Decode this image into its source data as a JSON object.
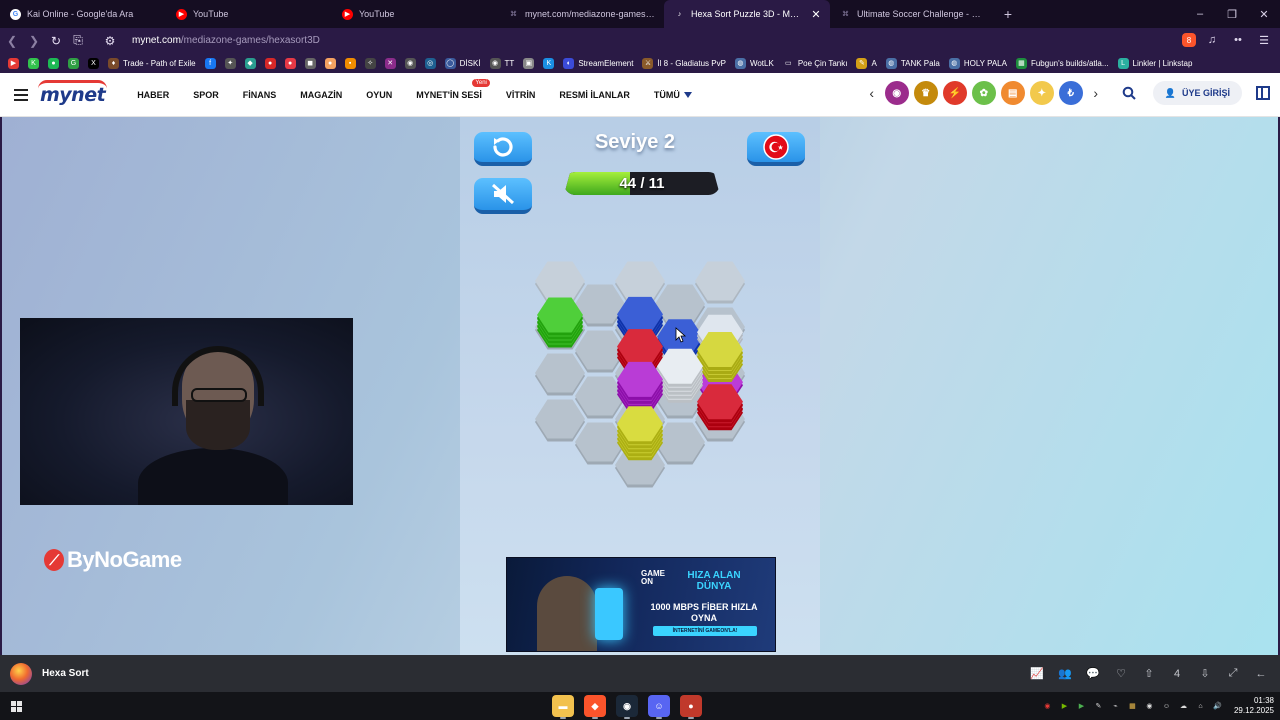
{
  "browser": {
    "tabs": [
      {
        "title": "Kai Online - Google'da Ara",
        "icon": "google-icon",
        "color": "#ffffff",
        "active": false
      },
      {
        "title": "YouTube",
        "icon": "youtube-icon",
        "color": "#ff0000",
        "active": false
      },
      {
        "title": "YouTube",
        "icon": "youtube-icon",
        "color": "#ff0000",
        "active": false
      },
      {
        "title": "mynet.com/mediazone-games/all-g",
        "icon": "link-icon",
        "color": "#8a7fa3",
        "active": false
      },
      {
        "title": "Hexa Sort Puzzle 3D - Media",
        "icon": "audio-icon",
        "color": "#ffffff",
        "active": true
      },
      {
        "title": "Ultimate Soccer Challenge - Mediaz",
        "icon": "link-icon",
        "color": "#8a7fa3",
        "active": false
      }
    ],
    "new_tab": "+",
    "window_controls": {
      "minimize": "–",
      "restore": "❐",
      "close": "✕"
    },
    "url_host": "mynet.com",
    "url_path": "/mediazone-games/hexasort3D",
    "brave_badge": "8",
    "bookmarks": [
      {
        "label": "",
        "color": "#e53935",
        "glyph": "▶"
      },
      {
        "label": "",
        "color": "#32c24d",
        "glyph": "K"
      },
      {
        "label": "",
        "color": "#1db954",
        "glyph": "●"
      },
      {
        "label": "",
        "color": "#2f9e44",
        "glyph": "G"
      },
      {
        "label": "",
        "color": "#000000",
        "glyph": "X"
      },
      {
        "label": "Trade - Path of Exile",
        "color": "#7a4a2a",
        "glyph": "♦"
      },
      {
        "label": "",
        "color": "#1877f2",
        "glyph": "f"
      },
      {
        "label": "",
        "color": "#555",
        "glyph": "✦"
      },
      {
        "label": "",
        "color": "#2a9d8f",
        "glyph": "◆"
      },
      {
        "label": "",
        "color": "#d62828",
        "glyph": "●"
      },
      {
        "label": "",
        "color": "#e63946",
        "glyph": "●"
      },
      {
        "label": "",
        "color": "#666",
        "glyph": "◼"
      },
      {
        "label": "",
        "color": "#f4a261",
        "glyph": "●"
      },
      {
        "label": "",
        "color": "#f08c00",
        "glyph": "▪"
      },
      {
        "label": "",
        "color": "#444",
        "glyph": "✧"
      },
      {
        "label": "",
        "color": "#8b2c8b",
        "glyph": "✕"
      },
      {
        "label": "",
        "color": "#555",
        "glyph": "◉"
      },
      {
        "label": "",
        "color": "#1e6091",
        "glyph": "◎"
      },
      {
        "label": "DİSKİ",
        "color": "#3a5a9c",
        "glyph": "◯"
      },
      {
        "label": "TT",
        "color": "#555",
        "glyph": "◉"
      },
      {
        "label": "",
        "color": "#888",
        "glyph": "▣"
      },
      {
        "label": "",
        "color": "#1a8fe3",
        "glyph": "K"
      },
      {
        "label": "StreamElement",
        "color": "#3b4bd8",
        "glyph": "◐"
      },
      {
        "label": "İl 8 - Gladiatus PvP",
        "color": "#8a5a2a",
        "glyph": "⚔"
      },
      {
        "label": "WotLK",
        "color": "#4a6fa5",
        "glyph": "◍"
      },
      {
        "label": "Poe Çin Tankı",
        "color": "#2a1a45",
        "glyph": "▭"
      },
      {
        "label": "A",
        "color": "#d4a017",
        "glyph": "✎"
      },
      {
        "label": "TANK Pala",
        "color": "#4a6fa5",
        "glyph": "◍"
      },
      {
        "label": "HOLY PALA",
        "color": "#4a6fa5",
        "glyph": "◍"
      },
      {
        "label": "Fubgun's builds/atla...",
        "color": "#1e8e3e",
        "glyph": "▦"
      },
      {
        "label": "Linkler | Linkstap",
        "color": "#2bb0a0",
        "glyph": "L"
      }
    ]
  },
  "site": {
    "logo": "mynet",
    "nav": [
      "HABER",
      "SPOR",
      "FİNANS",
      "MAGAZİN",
      "OYUN",
      "MYNET'İN SESİ",
      "VİTRİN",
      "RESMİ İLANLAR",
      "TÜMÜ"
    ],
    "new_badge": "Yeni",
    "app_icons": [
      {
        "name": "podcast-icon",
        "color": "#9b2c8c",
        "glyph": "◉"
      },
      {
        "name": "trophy-icon",
        "color": "#c48a0c",
        "glyph": "♛"
      },
      {
        "name": "flash-icon",
        "color": "#e03a2a",
        "glyph": "⚡"
      },
      {
        "name": "sport-icon",
        "color": "#6cc04a",
        "glyph": "✿"
      },
      {
        "name": "live-icon",
        "color": "#f08a30",
        "glyph": "▤"
      },
      {
        "name": "gift-icon",
        "color": "#f2c94c",
        "glyph": "✦"
      },
      {
        "name": "finance-icon",
        "color": "#3a6ed8",
        "glyph": "₺"
      }
    ],
    "login_label": "ÜYE GİRİŞİ"
  },
  "stream": {
    "brand": "ByNoGame"
  },
  "game": {
    "level": "Seviye 2",
    "progress_text": "44 / 11",
    "progress_fraction": 0.42,
    "flag": "Turkish flag",
    "ad": {
      "line1": "GAME ON",
      "line2": "HIZA ALAN DÜNYA",
      "line3": "1000 MBPS FİBER HIZLA OYNA",
      "line4": "İNTERNETİNİ GAMEON'LA!"
    }
  },
  "appbar": {
    "title": "Hexa Sort",
    "count": "4"
  },
  "taskbar": {
    "time": "01:38",
    "date": "29.12.2025",
    "apps": [
      {
        "name": "file-explorer-icon",
        "color": "#f2c14e",
        "glyph": "▬"
      },
      {
        "name": "brave-browser-icon",
        "color": "#fb542b",
        "glyph": "◆"
      },
      {
        "name": "steam-icon",
        "color": "#1b2838",
        "glyph": "◉"
      },
      {
        "name": "discord-icon",
        "color": "#5865f2",
        "glyph": "☺"
      },
      {
        "name": "obs-icon",
        "color": "#c0392b",
        "glyph": "●"
      }
    ]
  },
  "board_cells": [
    {
      "col": 0,
      "row": 0,
      "color": "#c6d0da"
    },
    {
      "col": 0,
      "row": 1,
      "color": "#b7c2cd"
    },
    {
      "col": 0,
      "row": 2,
      "color": "#b7c2cd"
    },
    {
      "col": 0,
      "row": 3,
      "color": "#b7c2cd"
    },
    {
      "col": 1,
      "row": 0.5,
      "color": "#b7c2cd"
    },
    {
      "col": 1,
      "row": 1.5,
      "color": "#b7c2cd"
    },
    {
      "col": 1,
      "row": 2.5,
      "color": "#b7c2cd"
    },
    {
      "col": 1,
      "row": 3.5,
      "color": "#b7c2cd"
    },
    {
      "col": 2,
      "row": 0,
      "color": "#c6d0da"
    },
    {
      "col": 2,
      "row": 1,
      "color": "#b7c2cd"
    },
    {
      "col": 2,
      "row": 2,
      "color": "#b7c2cd"
    },
    {
      "col": 2,
      "row": 3,
      "color": "#b7c2cd"
    },
    {
      "col": 2,
      "row": 4,
      "color": "#b7c2cd"
    },
    {
      "col": 3,
      "row": 0.5,
      "color": "#b7c2cd"
    },
    {
      "col": 3,
      "row": 1.5,
      "color": "#b7c2cd"
    },
    {
      "col": 3,
      "row": 2.5,
      "color": "#b7c2cd"
    },
    {
      "col": 3,
      "row": 3.5,
      "color": "#b7c2cd"
    },
    {
      "col": 4,
      "row": 0,
      "color": "#c6d0da"
    },
    {
      "col": 4,
      "row": 1,
      "color": "#b7c2cd"
    },
    {
      "col": 4,
      "row": 2,
      "color": "#b7c2cd"
    },
    {
      "col": 4,
      "row": 3,
      "color": "#b7c2cd"
    }
  ],
  "stacks": [
    {
      "col": 0,
      "row": 1,
      "color": "#4fcf3a",
      "height": 4
    },
    {
      "col": 2,
      "row": 0.9,
      "color": "#3b5fd6",
      "height": 3
    },
    {
      "col": 3,
      "row": 1.3,
      "color": "#3b5fd6",
      "height": 2
    },
    {
      "col": 4,
      "row": 1.2,
      "color": "#dfe6ee",
      "height": 2
    },
    {
      "col": 2,
      "row": 1.6,
      "color": "#d92a3c",
      "height": 3
    },
    {
      "col": 4,
      "row": 2.2,
      "color": "#bc3cd8",
      "height": 1
    },
    {
      "col": 4,
      "row": 1.75,
      "color": "#d6d840",
      "height": 4
    },
    {
      "col": 3,
      "row": 2.2,
      "color": "#e8edf2",
      "height": 5
    },
    {
      "col": 2,
      "row": 2.4,
      "color": "#b93cd6",
      "height": 4
    },
    {
      "col": 4,
      "row": 2.8,
      "color": "#d92a3c",
      "height": 3
    },
    {
      "col": 2,
      "row": 3.45,
      "color": "#d9dc40",
      "height": 5
    }
  ]
}
